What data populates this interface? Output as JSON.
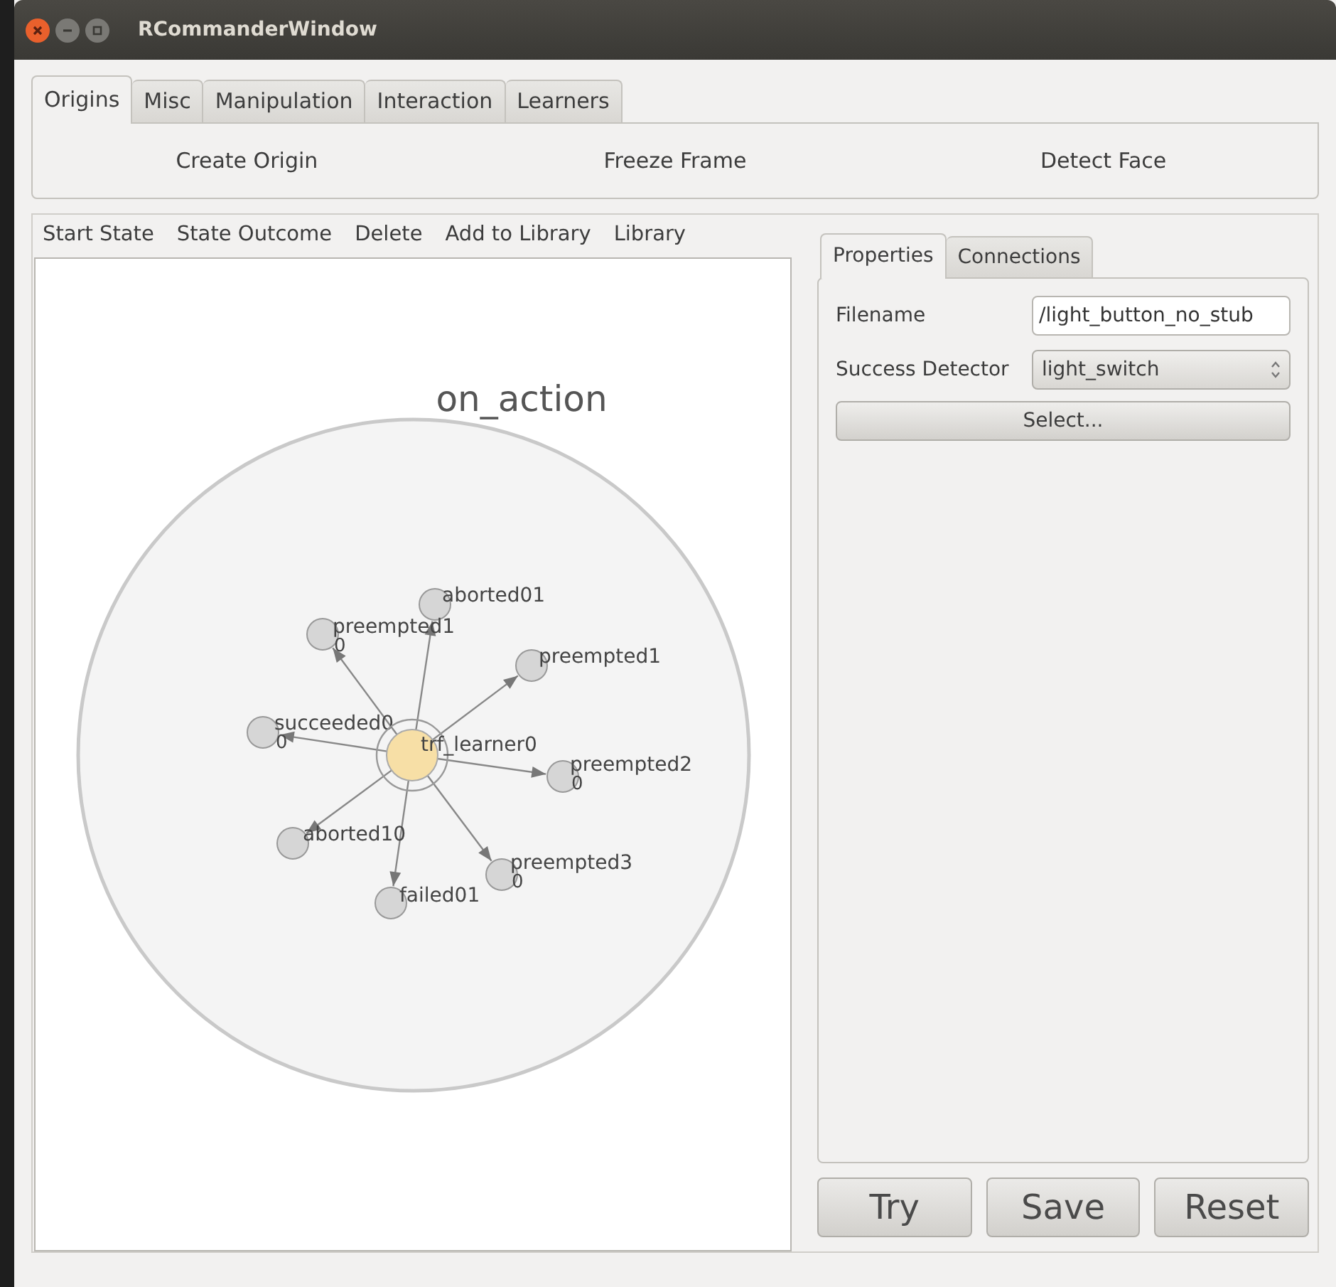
{
  "window": {
    "title": "RCommanderWindow"
  },
  "tabs": [
    {
      "label": "Origins",
      "selected": true
    },
    {
      "label": "Misc",
      "selected": false
    },
    {
      "label": "Manipulation",
      "selected": false
    },
    {
      "label": "Interaction",
      "selected": false
    },
    {
      "label": "Learners",
      "selected": false
    }
  ],
  "tab_buttons": [
    "Create Origin",
    "Freeze Frame",
    "Detect Face"
  ],
  "toolbar": [
    "Start State",
    "State Outcome",
    "Delete",
    "Add to Library",
    "Library"
  ],
  "graph": {
    "title": "on_action",
    "center": {
      "label": "trf_learner0"
    },
    "nodes": [
      {
        "label": "aborted01"
      },
      {
        "label": "preempted1",
        "sublabel": "0"
      },
      {
        "label": "preempted1"
      },
      {
        "label": "succeeded0",
        "sublabel": "0"
      },
      {
        "label": "preempted2",
        "sublabel": "0"
      },
      {
        "label": "aborted10"
      },
      {
        "label": "failed01"
      },
      {
        "label": "preempted3",
        "sublabel": "0"
      }
    ]
  },
  "side_tabs": [
    {
      "label": "Properties",
      "selected": true
    },
    {
      "label": "Connections",
      "selected": false
    }
  ],
  "properties": {
    "filename": {
      "label": "Filename",
      "value": "/light_button_no_stub"
    },
    "success_detector": {
      "label": "Success Detector",
      "value": "light_switch"
    },
    "select_button": "Select..."
  },
  "buttons": [
    "Try",
    "Save",
    "Reset"
  ]
}
